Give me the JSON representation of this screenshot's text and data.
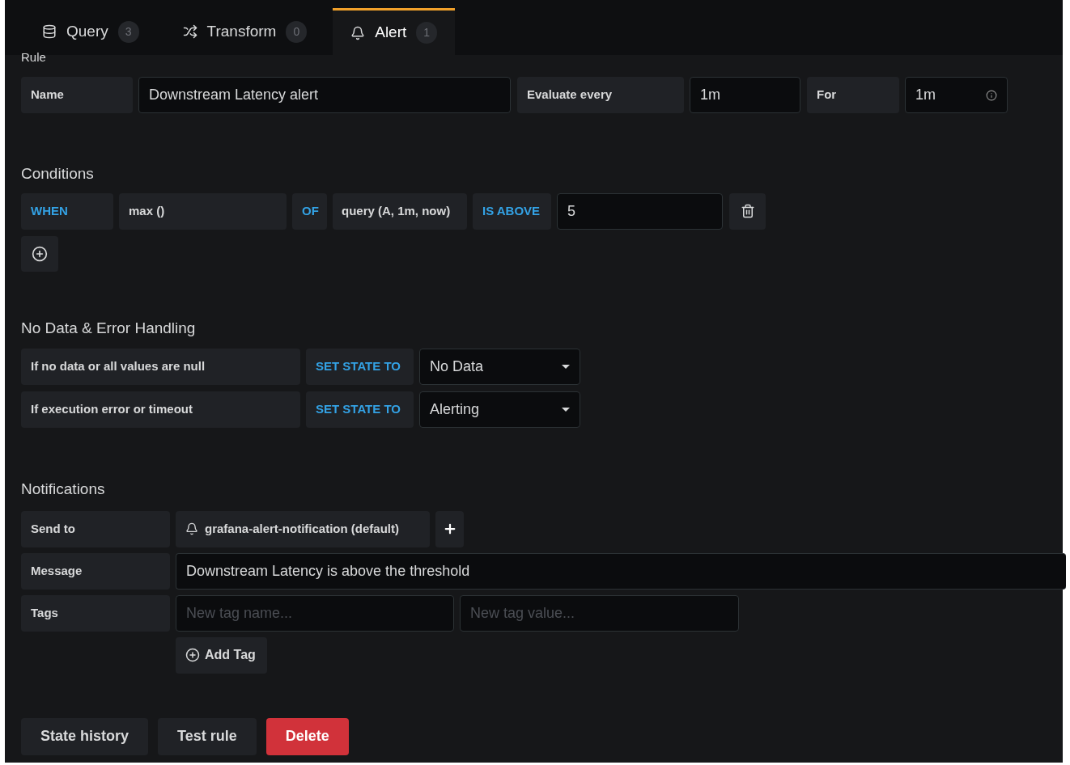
{
  "tabs": [
    {
      "kind": "query",
      "label": "Query",
      "count": "3",
      "selected": false
    },
    {
      "kind": "transform",
      "label": "Transform",
      "count": "0",
      "selected": false
    },
    {
      "kind": "alert",
      "label": "Alert",
      "count": "1",
      "selected": true
    }
  ],
  "rule": {
    "heading": "Rule",
    "name_label": "Name",
    "name_value": "Downstream Latency alert",
    "evaluate_label": "Evaluate every",
    "evaluate_value": "1m",
    "for_label": "For",
    "for_value": "1m"
  },
  "conditions": {
    "heading": "Conditions",
    "when": "WHEN",
    "reducer": "max ()",
    "of": "OF",
    "query": "query (A, 1m, now)",
    "evaluator": "IS ABOVE",
    "threshold": "5"
  },
  "no_data_handling": {
    "heading": "No Data & Error Handling",
    "rows": [
      {
        "label": "If no data or all values are null",
        "action": "SET STATE TO",
        "state": "No Data"
      },
      {
        "label": "If execution error or timeout",
        "action": "SET STATE TO",
        "state": "Alerting"
      }
    ]
  },
  "notifications": {
    "heading": "Notifications",
    "send_to_label": "Send to",
    "channel": "grafana-alert-notification (default)",
    "message_label": "Message",
    "message": "Downstream Latency is above the threshold",
    "tags_label": "Tags",
    "tag_name_placeholder": "New tag name...",
    "tag_value_placeholder": "New tag value...",
    "add_tag": "Add Tag"
  },
  "buttons": [
    {
      "kind": "secondary",
      "label": "State history"
    },
    {
      "kind": "secondary",
      "label": "Test rule"
    },
    {
      "kind": "danger",
      "label": "Delete"
    }
  ]
}
